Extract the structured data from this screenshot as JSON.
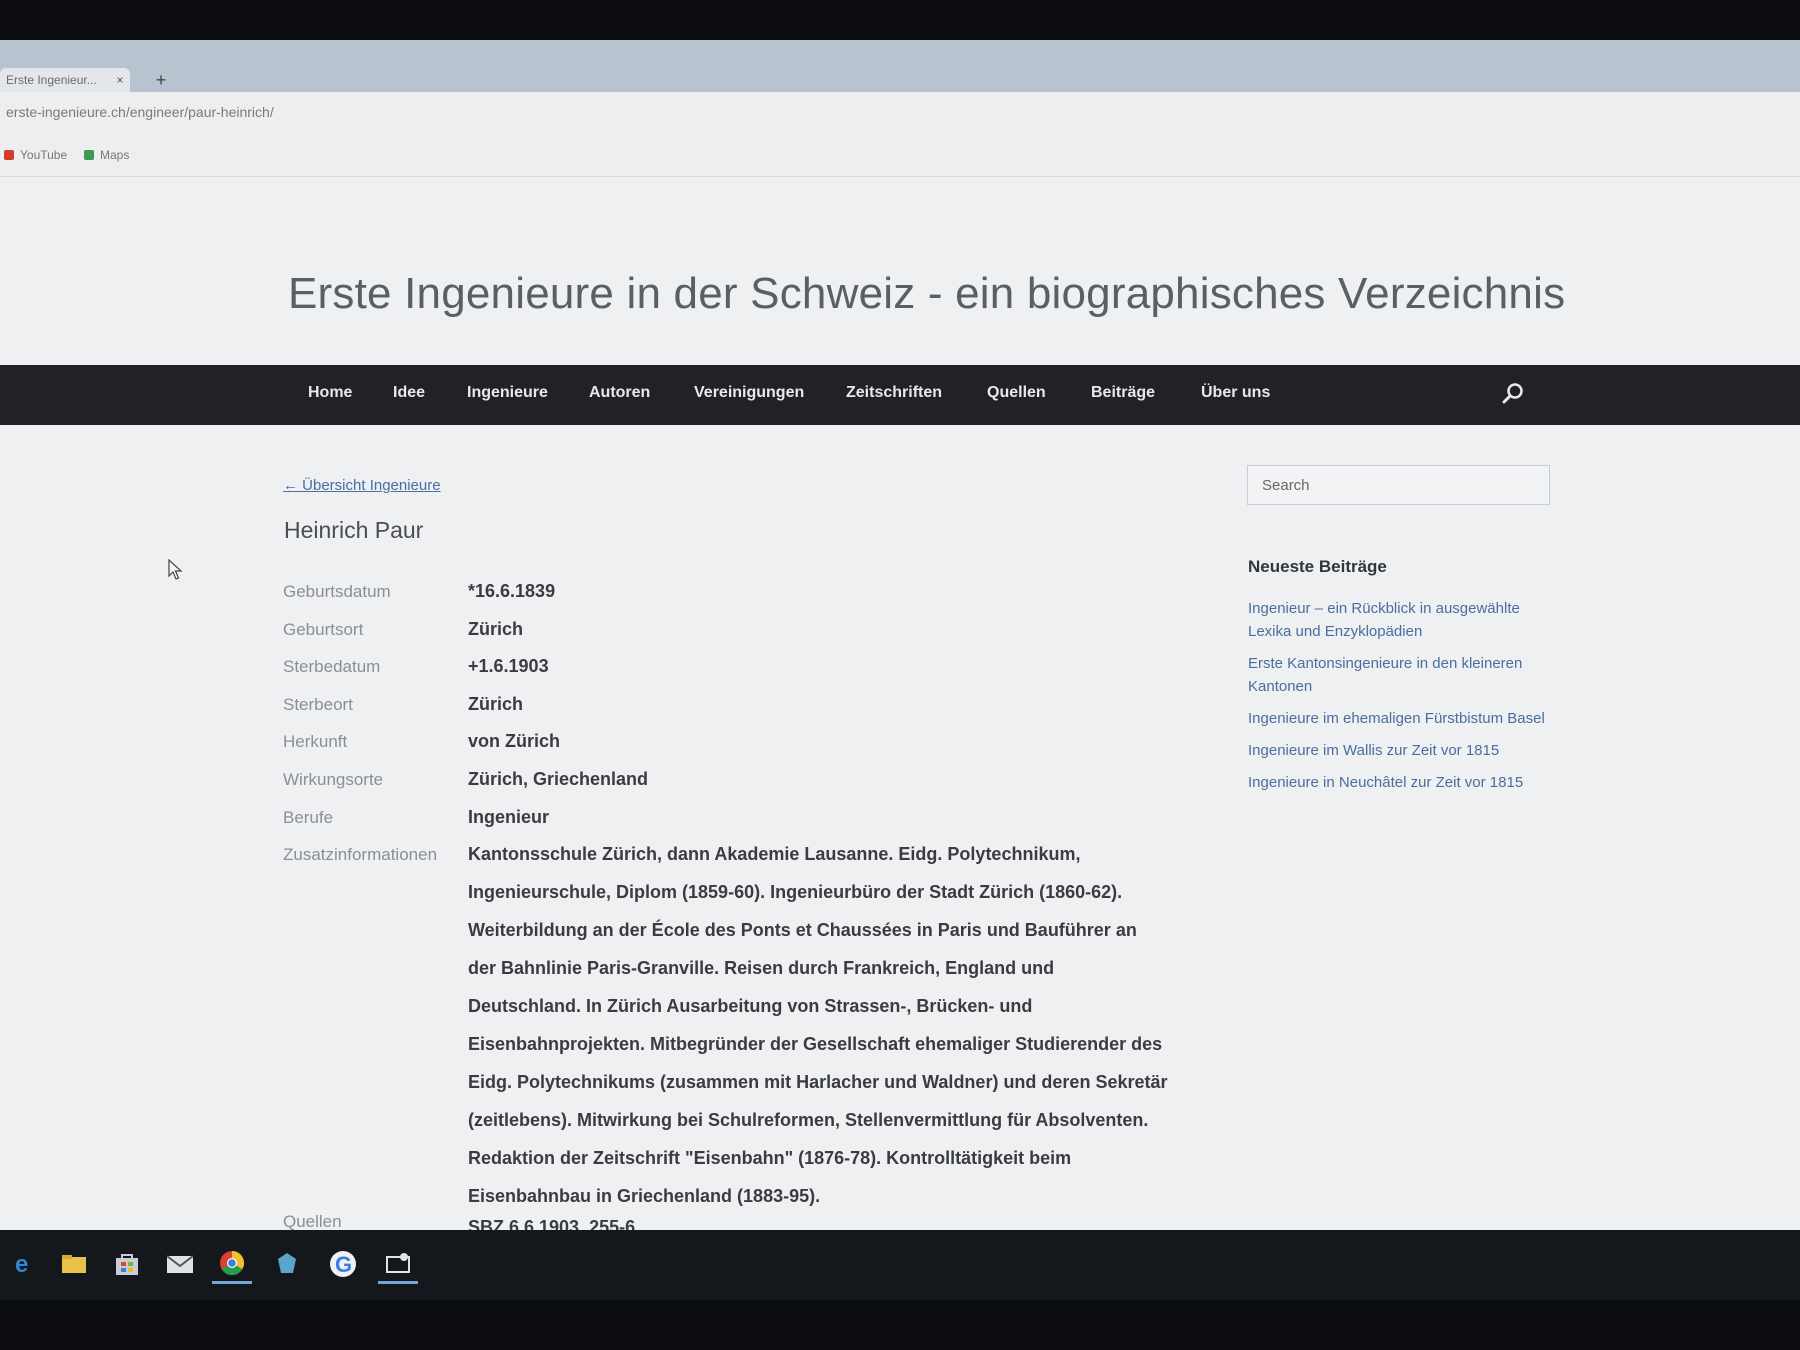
{
  "browser": {
    "tab_title": "Erste Ingenieur...",
    "tab_close": "×",
    "new_tab": "+",
    "url": "erste-ingenieure.ch/engineer/paur-heinrich/",
    "bookmarks": [
      "YouTube",
      "Maps"
    ]
  },
  "site": {
    "title": "Erste Ingenieure in der Schweiz - ein biographisches Verzeichnis"
  },
  "nav": {
    "items": [
      "Home",
      "Idee",
      "Ingenieure",
      "Autoren",
      "Vereinigungen",
      "Zeitschriften",
      "Quellen",
      "Beiträge",
      "Über uns"
    ],
    "search_icon": "search-icon"
  },
  "entry": {
    "back_link": "← Übersicht Ingenieure",
    "name": "Heinrich Paur",
    "fields": [
      {
        "label": "Geburtsdatum",
        "value": "*16.6.1839"
      },
      {
        "label": "Geburtsort",
        "value": "Zürich"
      },
      {
        "label": "Sterbedatum",
        "value": "+1.6.1903"
      },
      {
        "label": "Sterbeort",
        "value": "Zürich"
      },
      {
        "label": "Herkunft",
        "value": "von Zürich"
      },
      {
        "label": "Wirkungsorte",
        "value": "Zürich, Griechenland"
      },
      {
        "label": "Berufe",
        "value": "Ingenieur"
      }
    ],
    "zusatz_label": "Zusatzinformationen",
    "zusatz_text": "Kantonsschule Zürich, dann Akademie Lausanne. Eidg. Polytechnikum, Ingenieurschule, Diplom (1859-60). Ingenieurbüro der Stadt Zürich (1860-62). Weiterbildung an der École des Ponts et Chaussées in Paris und Bauführer an der Bahnlinie Paris-Granville. Reisen durch Frankreich, England und Deutschland. In Zürich Ausarbeitung von Strassen-, Brücken- und Eisenbahnprojekten. Mitbegründer der Gesellschaft ehemaliger Studierender des Eidg. Polytechnikums (zusammen mit Harlacher und Waldner) und deren Sekretär (zeitlebens). Mitwirkung bei Schulreformen, Stellenvermittlung für Absolventen. Redaktion der Zeitschrift \"Eisenbahn\" (1876-78). Kontrolltätigkeit beim Eisenbahnbau in Griechenland (1883-95).",
    "quellen_label": "Quellen",
    "quellen_value": "SBZ 6.6.1903, 255-6"
  },
  "sidebar": {
    "search_placeholder": "Search",
    "widget_title": "Neueste Beiträge",
    "posts": [
      "Ingenieur – ein Rückblick in ausgewählte Lexika und Enzyklopädien",
      "Erste Kantonsingenieure in den kleineren Kantonen",
      "Ingenieure im ehemaligen Fürstbistum Basel",
      "Ingenieure im Wallis zur Zeit vor 1815",
      "Ingenieure in Neuchâtel zur Zeit vor 1815"
    ]
  },
  "taskbar": {
    "icons": [
      "edge-icon",
      "file-explorer-icon",
      "store-icon",
      "mail-icon",
      "chrome-icon",
      "app-icon",
      "google-icon",
      "window-icon"
    ]
  }
}
